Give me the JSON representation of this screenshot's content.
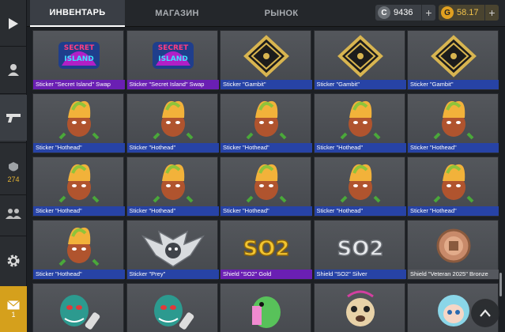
{
  "tabs": [
    {
      "label": "ИНВЕНТАРЬ",
      "active": true
    },
    {
      "label": "МАГАЗИН",
      "active": false
    },
    {
      "label": "РЫНОК",
      "active": false
    }
  ],
  "currencies": {
    "silver": {
      "icon": "C",
      "value": "9436",
      "color": "#3c4046"
    },
    "gold": {
      "icon": "G",
      "value": "58.17",
      "color": "#e0a020"
    }
  },
  "sidebar": {
    "play": "play-icon",
    "profile": "profile-icon",
    "weapons": "pistol-icon",
    "rank": "rank-icon",
    "rank_count": "274",
    "friends": "friends-icon",
    "settings": "gear-icon",
    "mail": "mail-icon",
    "mail_count": "1"
  },
  "items": [
    {
      "caption": "Sticker \"Secret Island\" Swap",
      "rarity": "purple",
      "art": "secret-island"
    },
    {
      "caption": "Sticker \"Secret Island\" Swap",
      "rarity": "purple",
      "art": "secret-island"
    },
    {
      "caption": "Sticker \"Gambit\"",
      "rarity": "blue",
      "art": "gambit"
    },
    {
      "caption": "Sticker \"Gambit\"",
      "rarity": "blue",
      "art": "gambit"
    },
    {
      "caption": "Sticker \"Gambit\"",
      "rarity": "blue",
      "art": "gambit"
    },
    {
      "caption": "Sticker \"Hothead\"",
      "rarity": "blue",
      "art": "hothead"
    },
    {
      "caption": "Sticker \"Hothead\"",
      "rarity": "blue",
      "art": "hothead"
    },
    {
      "caption": "Sticker \"Hothead\"",
      "rarity": "blue",
      "art": "hothead"
    },
    {
      "caption": "Sticker \"Hothead\"",
      "rarity": "blue",
      "art": "hothead"
    },
    {
      "caption": "Sticker \"Hothead\"",
      "rarity": "blue",
      "art": "hothead"
    },
    {
      "caption": "Sticker \"Hothead\"",
      "rarity": "blue",
      "art": "hothead"
    },
    {
      "caption": "Sticker \"Hothead\"",
      "rarity": "blue",
      "art": "hothead"
    },
    {
      "caption": "Sticker \"Hothead\"",
      "rarity": "blue",
      "art": "hothead"
    },
    {
      "caption": "Sticker \"Hothead\"",
      "rarity": "blue",
      "art": "hothead"
    },
    {
      "caption": "Sticker \"Hothead\"",
      "rarity": "blue",
      "art": "hothead"
    },
    {
      "caption": "Sticker \"Hothead\"",
      "rarity": "blue",
      "art": "hothead"
    },
    {
      "caption": "Sticker \"Prey\"",
      "rarity": "blue",
      "art": "prey"
    },
    {
      "caption": "Shield \"SO2\" Gold",
      "rarity": "purple",
      "art": "so2-gold"
    },
    {
      "caption": "Shield \"SO2\" Silver",
      "rarity": "blue",
      "art": "so2-silver"
    },
    {
      "caption": "Shield \"Veteran 2025\" Bronze",
      "rarity": "gray",
      "art": "veteran"
    },
    {
      "caption": "",
      "rarity": "none",
      "art": "monster"
    },
    {
      "caption": "",
      "rarity": "none",
      "art": "monster"
    },
    {
      "caption": "",
      "rarity": "none",
      "art": "dino"
    },
    {
      "caption": "",
      "rarity": "none",
      "art": "pug"
    },
    {
      "caption": "",
      "rarity": "none",
      "art": "girl"
    }
  ],
  "colors": {
    "rarity_blue": "#2743a6",
    "rarity_purple": "#6a1fb3",
    "rarity_gray": "#55585e",
    "accent_gold": "#e2b233"
  }
}
